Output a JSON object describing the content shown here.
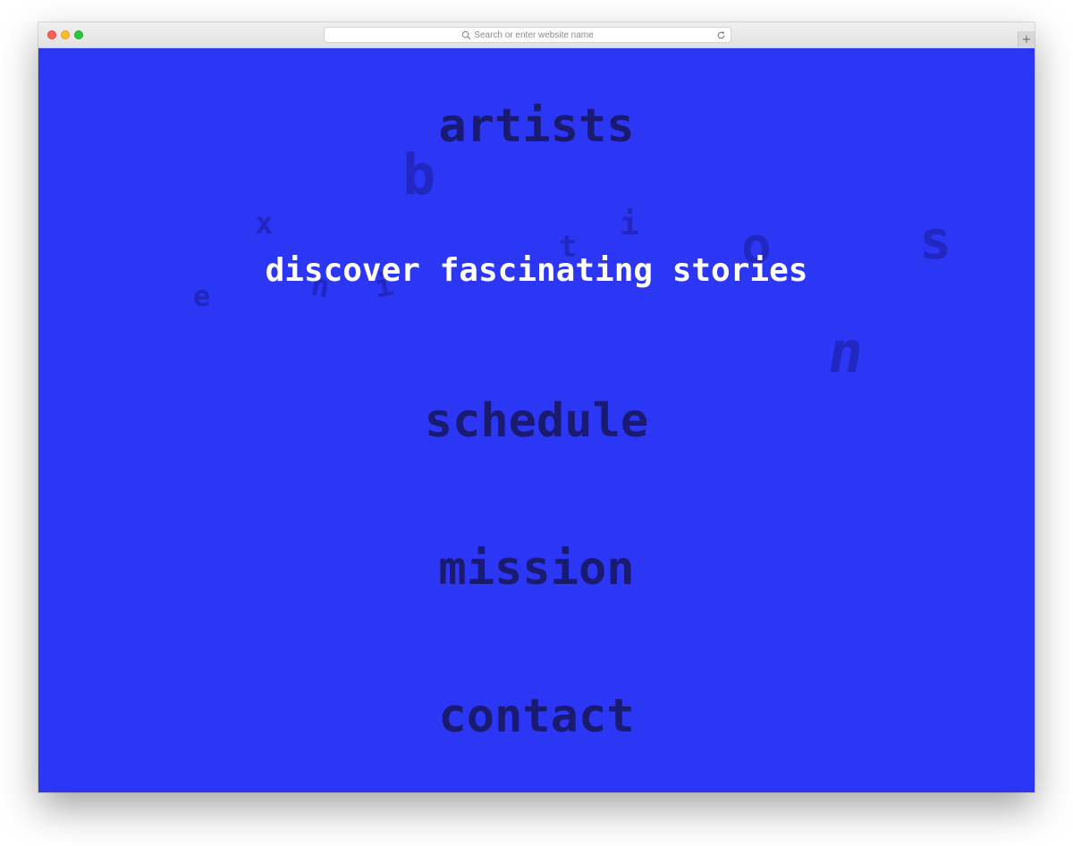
{
  "browser": {
    "address_placeholder": "Search or enter website name",
    "new_tab_label": "+"
  },
  "hero": {
    "text": "discover fascinating stories"
  },
  "nav": {
    "items": [
      {
        "label": "artists"
      },
      {
        "label": "schedule"
      },
      {
        "label": "mission"
      },
      {
        "label": "contact"
      }
    ]
  },
  "floating_letters": [
    "b",
    "x",
    "e",
    "n",
    "i",
    "t",
    "i",
    "o",
    "s",
    "n"
  ],
  "colors": {
    "background": "#2b37f5",
    "nav_text": "#1a1a6e",
    "hero_text": "#ffffff",
    "floating_letters": "#2127c0"
  }
}
